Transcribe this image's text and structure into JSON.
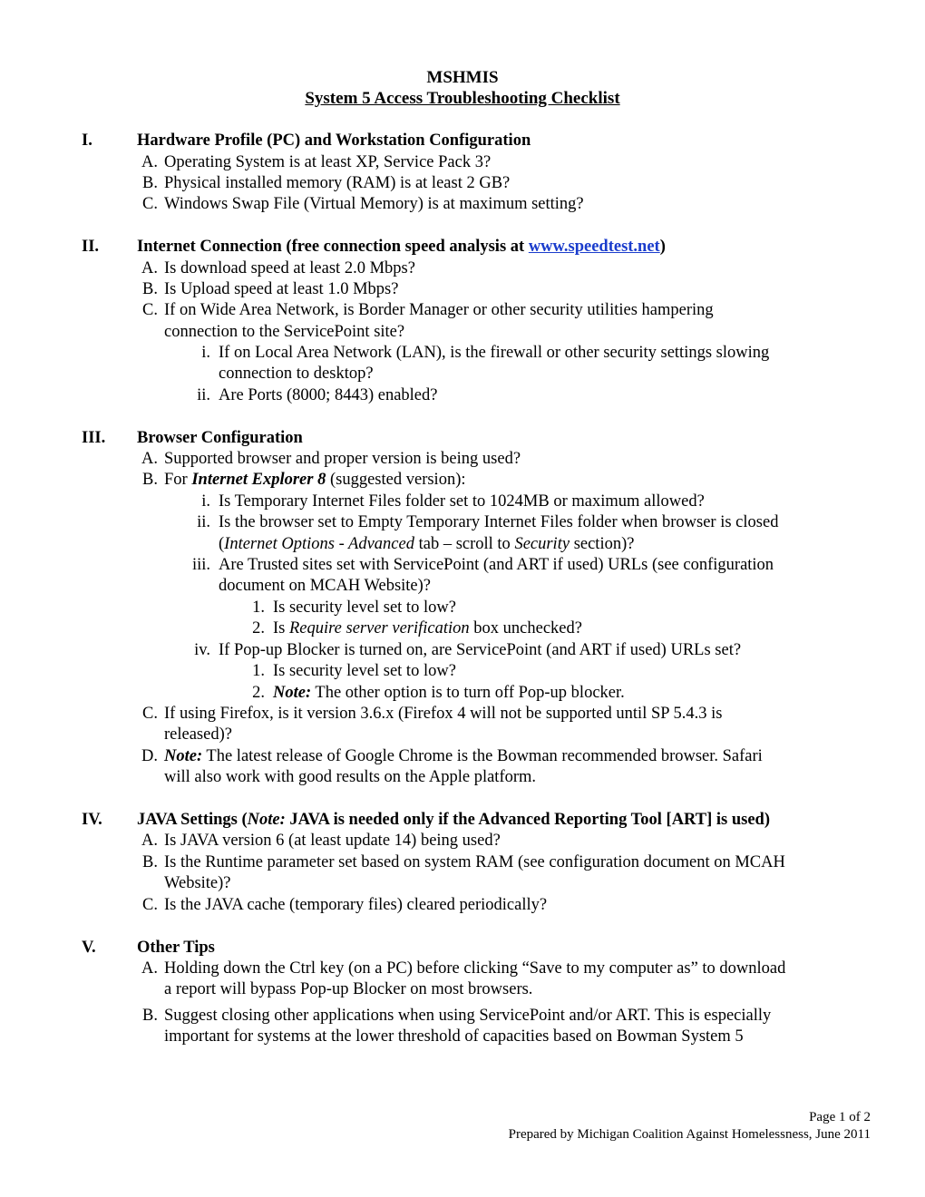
{
  "header": {
    "title": "MSHMIS",
    "subtitle": "System 5 Access Troubleshooting Checklist"
  },
  "sections": [
    {
      "num": "I.",
      "title": "Hardware Profile (PC) and Workstation Configuration",
      "items": [
        {
          "label": "A.",
          "text": "Operating System is at least XP, Service Pack 3?"
        },
        {
          "label": "B.",
          "text": "Physical installed memory (RAM) is at least 2 GB?"
        },
        {
          "label": "C.",
          "text": "Windows Swap File (Virtual Memory) is at maximum setting?"
        }
      ]
    },
    {
      "num": "II.",
      "title_prefix": "Internet Connection (free connection speed analysis at ",
      "title_link": "www.speedtest.net",
      "title_suffix": ")",
      "items": [
        {
          "label": "A.",
          "text": "Is download speed at least 2.0 Mbps?"
        },
        {
          "label": "B.",
          "text": "Is Upload speed at least 1.0 Mbps?"
        },
        {
          "label": "C.",
          "text": "If on Wide Area Network, is Border Manager or other security utilities hampering",
          "text2": "connection to the ServicePoint site?"
        },
        {
          "label": "i.",
          "text": "If on Local Area Network (LAN), is the firewall or other security settings slowing",
          "text2": "connection to desktop?"
        },
        {
          "label": "ii.",
          "text": "Are Ports (8000; 8443) enabled?"
        }
      ]
    },
    {
      "num": "III.",
      "title": "Browser Configuration",
      "items": [
        {
          "label": "A.",
          "text": "Supported browser and proper version is being used?"
        },
        {
          "label": "B.",
          "text_pre": "For ",
          "text_emph": "Internet Explorer 8",
          "text_post": " (suggested version):"
        },
        {
          "label": "i.",
          "text": "Is Temporary Internet Files folder set to 1024MB or maximum allowed?"
        },
        {
          "label": "ii.",
          "text": "Is the browser set to Empty Temporary Internet Files folder when browser is closed",
          "l2_a": "(",
          "l2_i1": "Internet Options - Advanced",
          "l2_b": " tab – scroll to ",
          "l2_i2": "Security",
          "l2_c": " section)?"
        },
        {
          "label": "iii.",
          "text": "Are Trusted sites set with ServicePoint (and ART if used) URLs (see configuration",
          "text2": "document on MCAH Website)?"
        },
        {
          "label": "1.",
          "text": "Is security level set to low?"
        },
        {
          "label": "2.",
          "text_pre": "Is ",
          "text_emph": "Require server verification",
          "text_post": " box unchecked?"
        },
        {
          "label": "iv.",
          "text": "If Pop-up Blocker is turned on, are ServicePoint (and ART if used) URLs set?"
        },
        {
          "label": "1.",
          "text": "Is security level set to low?"
        },
        {
          "label": "2.",
          "text_emph": "Note:",
          "text_post": " The other option is to turn off Pop-up blocker."
        },
        {
          "label": "C.",
          "text": "If using Firefox, is it version 3.6.x (Firefox 4 will not be supported until SP 5.4.3 is",
          "text2": "released)?"
        },
        {
          "label": "D.",
          "text_emph": "Note:",
          "text_post": " The latest release of Google Chrome is the Bowman recommended browser.  Safari",
          "text2": "will also work with good results on the Apple platform."
        }
      ]
    },
    {
      "num": "IV.",
      "title_pre": "JAVA Settings (",
      "title_emph": "Note:",
      "title_post": " JAVA is needed only if the Advanced Reporting Tool  [ART] is used)",
      "items": [
        {
          "label": "A.",
          "text": "Is JAVA version 6 (at least update 14) being used?"
        },
        {
          "label": "B.",
          "text": "Is the Runtime parameter set based on system RAM (see configuration document on MCAH",
          "text2": "Website)?"
        },
        {
          "label": "C.",
          "text": "Is the JAVA cache (temporary files) cleared periodically?"
        }
      ]
    },
    {
      "num": "V.",
      "title": "Other Tips",
      "items": [
        {
          "label": "A.",
          "text": "Holding down the Ctrl key (on a PC) before clicking “Save to my computer as” to download",
          "text2": "a report will bypass Pop-up Blocker on most browsers."
        },
        {
          "label": "B.",
          "text": "Suggest closing other applications when using ServicePoint and/or ART.  This is especially",
          "text2": "important for systems at the lower threshold of capacities based on Bowman System 5"
        }
      ]
    }
  ],
  "footer": {
    "page": "Page 1 of 2",
    "prepared_by": "Prepared by Michigan Coalition Against Homelessness, June 2011"
  },
  "colors": {
    "link": "#1a3ccc",
    "text": "#000000"
  }
}
